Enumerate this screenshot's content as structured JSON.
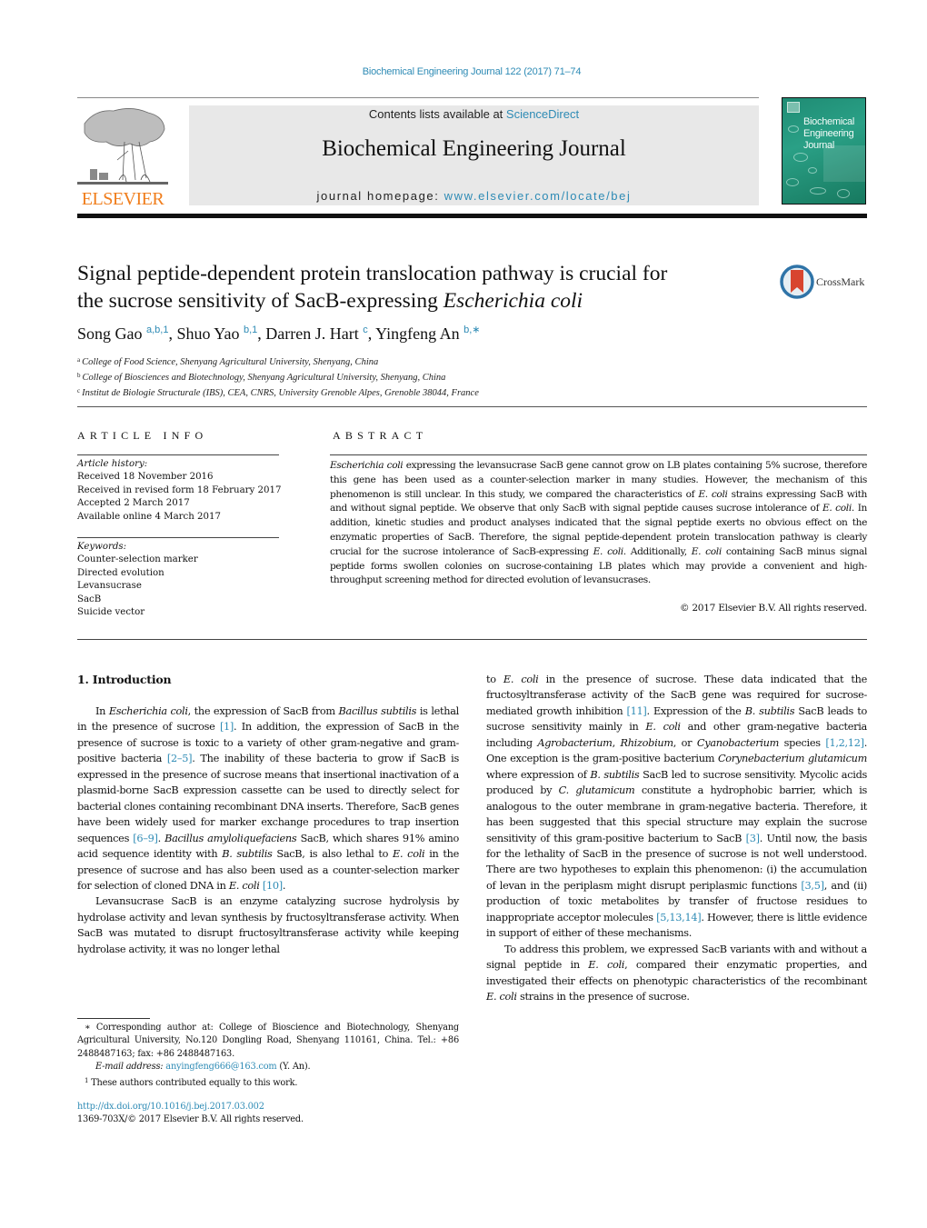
{
  "header": {
    "citation": "Biochemical Engineering Journal 122 (2017) 71–74",
    "publisher_logo_text": "ELSEVIER",
    "contents_prefix": "Contents lists available at ",
    "contents_link": "ScienceDirect",
    "journal_title": "Biochemical Engineering Journal",
    "homepage_prefix": "journal homepage: ",
    "homepage_url": "www.elsevier.com/locate/bej",
    "cover_title_lines": [
      "Biochemical",
      "Engineering",
      "Journal"
    ],
    "crossmark_label": "CrossMark"
  },
  "colors": {
    "link": "#2e8bb5",
    "elsevier_orange": "#f07d1b",
    "cover_green": "#1f8c74",
    "masthead_gray": "#e8e8e8"
  },
  "article": {
    "title_line1": "Signal peptide-dependent protein translocation pathway is crucial for",
    "title_line2_prefix": "the sucrose sensitivity of SacB-expressing ",
    "title_line2_italic": "Escherichia coli",
    "authors": [
      {
        "name": "Song Gao",
        "marks": "a,b,1"
      },
      {
        "name": "Shuo Yao",
        "marks": "b,1"
      },
      {
        "name": "Darren J. Hart",
        "marks": "c"
      },
      {
        "name": "Yingfeng An",
        "marks": "b,∗"
      }
    ],
    "affiliations": [
      {
        "mark": "a",
        "text": "College of Food Science, Shenyang Agricultural University, Shenyang, China"
      },
      {
        "mark": "b",
        "text": "College of Biosciences and Biotechnology, Shenyang Agricultural University, Shenyang, China"
      },
      {
        "mark": "c",
        "text": "Institut de Biologie Structurale (IBS), CEA, CNRS, University Grenoble Alpes, Grenoble 38044, France"
      }
    ]
  },
  "article_info": {
    "heading": "ARTICLE INFO",
    "history_label": "Article history:",
    "history": [
      "Received 18 November 2016",
      "Received in revised form 18 February 2017",
      "Accepted 2 March 2017",
      "Available online 4 March 2017"
    ],
    "keywords_label": "Keywords:",
    "keywords": [
      "Counter-selection marker",
      "Directed evolution",
      "Levansucrase",
      "SacB",
      "Suicide vector"
    ]
  },
  "abstract": {
    "heading": "ABSTRACT",
    "segments": [
      {
        "t": "Escherichia coli",
        "i": true
      },
      {
        "t": " expressing the levansucrase SacB gene cannot grow on LB plates containing 5% sucrose, therefore this gene has been used as a counter-selection marker in many studies. However, the mechanism of this phenomenon is still unclear. In this study, we compared the characteristics of "
      },
      {
        "t": "E. coli",
        "i": true
      },
      {
        "t": " strains expressing SacB with and without signal peptide. We observe that only SacB with signal peptide causes sucrose intolerance of "
      },
      {
        "t": "E. coli",
        "i": true
      },
      {
        "t": ". In addition, kinetic studies and product analyses indicated that the signal peptide exerts no obvious effect on the enzymatic properties of SacB. Therefore, the signal peptide-dependent protein translocation pathway is clearly crucial for the sucrose intolerance of SacB-expressing "
      },
      {
        "t": "E. coli",
        "i": true
      },
      {
        "t": ". Additionally, "
      },
      {
        "t": "E. coli",
        "i": true
      },
      {
        "t": " containing SacB minus signal peptide forms swollen colonies on sucrose-containing LB plates which may provide a convenient and high-throughput screening method for directed evolution of levansucrases."
      }
    ],
    "copyright": "© 2017 Elsevier B.V. All rights reserved."
  },
  "body": {
    "section_heading": "1.  Introduction",
    "left_paragraphs": [
      [
        {
          "t": "In "
        },
        {
          "t": "Escherichia coli",
          "i": true
        },
        {
          "t": ", the expression of SacB from "
        },
        {
          "t": "Bacillus subtilis",
          "i": true
        },
        {
          "t": " is lethal in the presence of sucrose "
        },
        {
          "t": "[1]",
          "ref": true
        },
        {
          "t": ". In addition, the expression of SacB in the presence of sucrose is toxic to a variety of other gram-negative and gram-positive bacteria "
        },
        {
          "t": "[2–5]",
          "ref": true
        },
        {
          "t": ". The inability of these bacteria to grow if SacB is expressed in the presence of sucrose means that insertional inactivation of a plasmid-borne SacB expression cassette can be used to directly select for bacterial clones containing recombinant DNA inserts. Therefore, SacB genes have been widely used for marker exchange procedures to trap insertion sequences "
        },
        {
          "t": "[6–9]",
          "ref": true
        },
        {
          "t": ". "
        },
        {
          "t": "Bacillus amyloliquefaciens",
          "i": true
        },
        {
          "t": " SacB, which shares 91% amino acid sequence identity with "
        },
        {
          "t": "B. subtilis",
          "i": true
        },
        {
          "t": " SacB, is also lethal to "
        },
        {
          "t": "E. coli",
          "i": true
        },
        {
          "t": " in the presence of sucrose and has also been used as a counter-selection marker for selection of cloned DNA in "
        },
        {
          "t": "E. coli",
          "i": true
        },
        {
          "t": " "
        },
        {
          "t": "[10]",
          "ref": true
        },
        {
          "t": "."
        }
      ],
      [
        {
          "t": "Levansucrase SacB is an enzyme catalyzing sucrose hydrolysis by hydrolase activity and levan synthesis by fructosyltransferase activity. When SacB was mutated to disrupt fructosyltransferase activity while keeping hydrolase activity, it was no longer lethal"
        }
      ]
    ],
    "right_paragraphs": [
      [
        {
          "t": "to "
        },
        {
          "t": "E. coli",
          "i": true
        },
        {
          "t": " in the presence of sucrose. These data indicated that the fructosyltransferase activity of the SacB gene was required for sucrose-mediated growth inhibition "
        },
        {
          "t": "[11]",
          "ref": true
        },
        {
          "t": ". Expression of the "
        },
        {
          "t": "B. subtilis",
          "i": true
        },
        {
          "t": " SacB leads to sucrose sensitivity mainly in "
        },
        {
          "t": "E. coli",
          "i": true
        },
        {
          "t": " and other gram-negative bacteria including "
        },
        {
          "t": "Agrobacterium",
          "i": true
        },
        {
          "t": ", "
        },
        {
          "t": "Rhizobium",
          "i": true
        },
        {
          "t": ", or "
        },
        {
          "t": "Cyanobacterium",
          "i": true
        },
        {
          "t": " species "
        },
        {
          "t": "[1,2,12]",
          "ref": true
        },
        {
          "t": ". One exception is the gram-positive bacterium "
        },
        {
          "t": "Corynebacterium glutamicum",
          "i": true
        },
        {
          "t": " where expression of "
        },
        {
          "t": "B. subtilis",
          "i": true
        },
        {
          "t": " SacB led to sucrose sensitivity. Mycolic acids produced by "
        },
        {
          "t": "C. glutamicum",
          "i": true
        },
        {
          "t": " constitute a hydrophobic barrier, which is analogous to the outer membrane in gram-negative bacteria. Therefore, it has been suggested that this special structure may explain the sucrose sensitivity of this gram-positive bacterium to SacB "
        },
        {
          "t": "[3]",
          "ref": true
        },
        {
          "t": ". Until now, the basis for the lethality of SacB in the presence of sucrose is not well understood. There are two hypotheses to explain this phenomenon: (i) the accumulation of levan in the periplasm might disrupt periplasmic functions "
        },
        {
          "t": "[3,5]",
          "ref": true
        },
        {
          "t": ", and (ii) production of toxic metabolites by transfer of fructose residues to inappropriate acceptor molecules "
        },
        {
          "t": "[5,13,14]",
          "ref": true
        },
        {
          "t": ". However, there is little evidence in support of either of these mechanisms."
        }
      ],
      [
        {
          "t": "To address this problem, we expressed SacB variants with and without a signal peptide in "
        },
        {
          "t": "E. coli",
          "i": true
        },
        {
          "t": ", compared their enzymatic properties, and investigated their effects on phenotypic characteristics of the recombinant "
        },
        {
          "t": "E. coli",
          "i": true
        },
        {
          "t": " strains in the presence of sucrose."
        }
      ]
    ]
  },
  "footnotes": {
    "corresponding": "∗  Corresponding author at: College of Bioscience and Biotechnology, Shenyang Agricultural University, No.120 Dongling Road, Shenyang 110161, China. Tel.: +86 2488487163; fax: +86 2488487163.",
    "email_label": "E-mail address: ",
    "email": "anyingfeng666@163.com",
    "email_suffix": " (Y. An).",
    "equal_mark": "1",
    "equal_text": " These authors contributed equally to this work.",
    "doi": "http://dx.doi.org/10.1016/j.bej.2017.03.002",
    "issn": "1369-703X/© 2017 Elsevier B.V. All rights reserved."
  }
}
